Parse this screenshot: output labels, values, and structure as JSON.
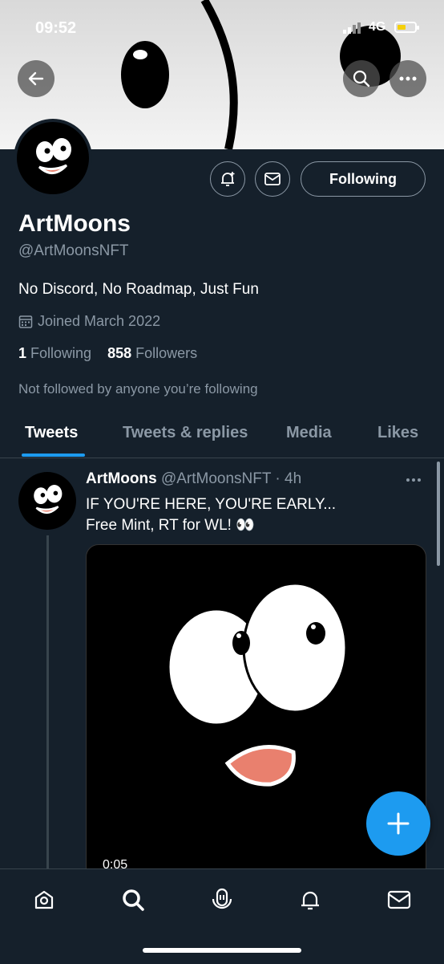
{
  "status_bar": {
    "time": "09:52",
    "network": "4G"
  },
  "profile": {
    "name": "ArtMoons",
    "handle": "@ArtMoonsNFT",
    "bio": "No Discord, No Roadmap, Just Fun",
    "joined": "Joined March 2022",
    "following_count": "1",
    "following_label": "Following",
    "followers_count": "858",
    "followers_label": "Followers",
    "not_followed_note": "Not followed by anyone you’re following",
    "follow_button_label": "Following"
  },
  "tabs": [
    {
      "label": "Tweets",
      "active": true
    },
    {
      "label": "Tweets & replies",
      "active": false
    },
    {
      "label": "Media",
      "active": false
    },
    {
      "label": "Likes",
      "active": false
    }
  ],
  "tweet": {
    "author": "ArtMoons",
    "handle": "@ArtMoonsNFT",
    "time": "· 4h",
    "line1": "IF YOU'RE HERE, YOU'RE EARLY...",
    "line2": "Free Mint, RT for WL! 👀",
    "video_duration": "0:05"
  },
  "bottom_nav": [
    "home-icon",
    "search-icon",
    "spaces-icon",
    "notifications-icon",
    "messages-icon"
  ],
  "colors": {
    "accent": "#1d9bf0",
    "background": "#15202b",
    "secondary_text": "#8b98a5"
  }
}
